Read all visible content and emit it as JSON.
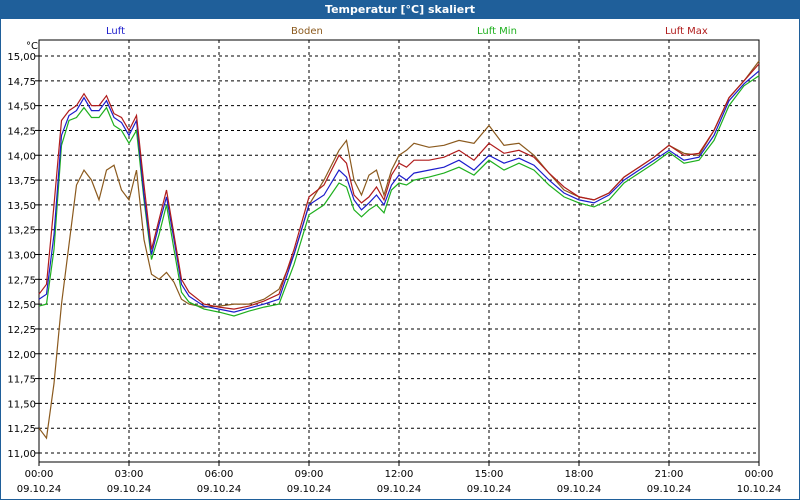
{
  "title": "Temperatur [°C] skaliert",
  "colors": {
    "title_bar": "#1f5f9a",
    "grid": "#000000",
    "luft": "#1c1ccc",
    "boden": "#8b5a1e",
    "luft_min": "#1fb01f",
    "luft_max": "#b01c1c"
  },
  "chart_data": {
    "type": "line",
    "title": "Temperatur [°C] skaliert",
    "ylabel": "°C",
    "xlabel": "",
    "ylim": [
      11.0,
      15.0
    ],
    "y_ticks": [
      "15,00",
      "14,75",
      "14,50",
      "14,25",
      "14,00",
      "13,75",
      "13,50",
      "13,25",
      "13,00",
      "12,75",
      "12,50",
      "12,25",
      "12,00",
      "11,75",
      "11,50",
      "11,25",
      "11,00"
    ],
    "x_ticks": [
      {
        "time": "00:00",
        "date": "09.10.24"
      },
      {
        "time": "03:00",
        "date": "09.10.24"
      },
      {
        "time": "06:00",
        "date": "09.10.24"
      },
      {
        "time": "09:00",
        "date": "09.10.24"
      },
      {
        "time": "12:00",
        "date": "09.10.24"
      },
      {
        "time": "15:00",
        "date": "09.10.24"
      },
      {
        "time": "18:00",
        "date": "09.10.24"
      },
      {
        "time": "21:00",
        "date": "09.10.24"
      },
      {
        "time": "00:00",
        "date": "10.10.24"
      }
    ],
    "grid": true,
    "legend_position": "top",
    "x_hours": [
      0,
      0.25,
      0.5,
      0.75,
      1,
      1.25,
      1.5,
      1.75,
      2,
      2.25,
      2.5,
      2.75,
      3,
      3.25,
      3.5,
      3.75,
      4,
      4.25,
      4.5,
      4.75,
      5,
      5.5,
      6,
      6.5,
      7,
      7.5,
      8,
      8.5,
      9,
      9.5,
      10,
      10.25,
      10.5,
      10.75,
      11,
      11.25,
      11.5,
      11.75,
      12,
      12.25,
      12.5,
      13,
      13.5,
      14,
      14.5,
      15,
      15.5,
      16,
      16.5,
      17,
      17.5,
      18,
      18.5,
      19,
      19.5,
      20,
      20.5,
      21,
      21.5,
      22,
      22.5,
      23,
      23.5,
      24
    ],
    "series": [
      {
        "name": "Luft",
        "color_key": "luft",
        "values": [
          12.55,
          12.6,
          13.2,
          14.2,
          14.4,
          14.45,
          14.58,
          14.45,
          14.45,
          14.55,
          14.38,
          14.33,
          14.2,
          14.35,
          13.6,
          13.0,
          13.3,
          13.58,
          13.15,
          12.7,
          12.58,
          12.48,
          12.45,
          12.42,
          12.46,
          12.5,
          12.55,
          13.0,
          13.5,
          13.6,
          13.85,
          13.78,
          13.55,
          13.45,
          13.52,
          13.6,
          13.5,
          13.7,
          13.8,
          13.75,
          13.82,
          13.85,
          13.88,
          13.95,
          13.85,
          14.0,
          13.92,
          13.97,
          13.9,
          13.75,
          13.62,
          13.55,
          13.52,
          13.6,
          13.75,
          13.85,
          13.95,
          14.05,
          13.95,
          13.98,
          14.2,
          14.55,
          14.72,
          14.85
        ]
      },
      {
        "name": "Boden",
        "color_key": "boden",
        "values": [
          11.25,
          11.15,
          11.7,
          12.5,
          13.1,
          13.7,
          13.85,
          13.75,
          13.55,
          13.85,
          13.9,
          13.65,
          13.55,
          13.85,
          13.15,
          12.8,
          12.75,
          12.82,
          12.72,
          12.55,
          12.5,
          12.47,
          12.48,
          12.5,
          12.5,
          12.55,
          12.65,
          13.0,
          13.5,
          13.75,
          14.05,
          14.15,
          13.75,
          13.6,
          13.8,
          13.85,
          13.6,
          13.85,
          14.0,
          14.05,
          14.12,
          14.08,
          14.1,
          14.15,
          14.12,
          14.3,
          14.1,
          14.12,
          14.0,
          13.82,
          13.65,
          13.58,
          13.55,
          13.62,
          13.78,
          13.88,
          13.98,
          14.1,
          14.02,
          14.0,
          14.25,
          14.58,
          14.75,
          14.95
        ]
      },
      {
        "name": "Luft Min",
        "color_key": "luft_min",
        "values": [
          12.48,
          12.5,
          13.05,
          14.1,
          14.35,
          14.38,
          14.48,
          14.38,
          14.38,
          14.48,
          14.3,
          14.25,
          14.12,
          14.25,
          13.55,
          12.95,
          13.2,
          13.5,
          13.05,
          12.62,
          12.52,
          12.45,
          12.42,
          12.38,
          12.43,
          12.47,
          12.5,
          12.9,
          13.4,
          13.5,
          13.72,
          13.68,
          13.45,
          13.38,
          13.45,
          13.5,
          13.42,
          13.65,
          13.72,
          13.7,
          13.75,
          13.78,
          13.82,
          13.88,
          13.8,
          13.95,
          13.85,
          13.92,
          13.85,
          13.7,
          13.58,
          13.52,
          13.48,
          13.55,
          13.72,
          13.82,
          13.92,
          14.03,
          13.92,
          13.95,
          14.15,
          14.5,
          14.7,
          14.8
        ]
      },
      {
        "name": "Luft Max",
        "color_key": "luft_max",
        "values": [
          12.6,
          12.7,
          13.5,
          14.35,
          14.45,
          14.5,
          14.62,
          14.5,
          14.5,
          14.6,
          14.42,
          14.38,
          14.25,
          14.4,
          13.7,
          13.05,
          13.35,
          13.65,
          13.2,
          12.75,
          12.62,
          12.5,
          12.47,
          12.45,
          12.48,
          12.53,
          12.6,
          13.05,
          13.58,
          13.7,
          14.0,
          13.92,
          13.6,
          13.52,
          13.58,
          13.68,
          13.55,
          13.8,
          13.92,
          13.88,
          13.95,
          13.95,
          13.98,
          14.05,
          13.95,
          14.12,
          14.02,
          14.05,
          13.98,
          13.82,
          13.68,
          13.58,
          13.55,
          13.62,
          13.78,
          13.88,
          13.98,
          14.1,
          14.0,
          14.02,
          14.25,
          14.58,
          14.75,
          14.92
        ]
      }
    ]
  }
}
